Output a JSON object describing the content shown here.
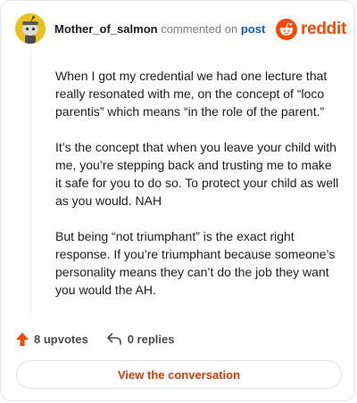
{
  "header": {
    "username": "Mother_of_salmon",
    "action_text": "commented on",
    "post_link": "post",
    "brand_name": "reddit"
  },
  "comment": {
    "paragraphs": [
      "When I got my credential we had one lecture that really resonated with me, on the concept of “loco parentis” which means “in the role of the parent.”",
      "It’s the concept that when you leave your child with me, you’re stepping back and trusting me to make it safe for you to do so. To protect your child as well as you would. NAH",
      "But being “not triumphant” is the exact right response. If you’re triumphant because someone’s personality means they can’t do the job they want you would the AH."
    ]
  },
  "actions": {
    "upvotes": "8 upvotes",
    "replies": "0 replies"
  },
  "footer": {
    "view_button": "View the conversation"
  },
  "icons": {
    "avatar": "snoo-avatar-icon",
    "brand": "reddit-logo-icon",
    "upvote": "upvote-arrow-icon",
    "reply": "reply-arrow-icon"
  },
  "colors": {
    "brand": "#ff4500",
    "link": "#0b5ec4",
    "upvote": "#ff4500",
    "avatar_bg": "#e8c21a",
    "button_text": "#d93a00"
  }
}
